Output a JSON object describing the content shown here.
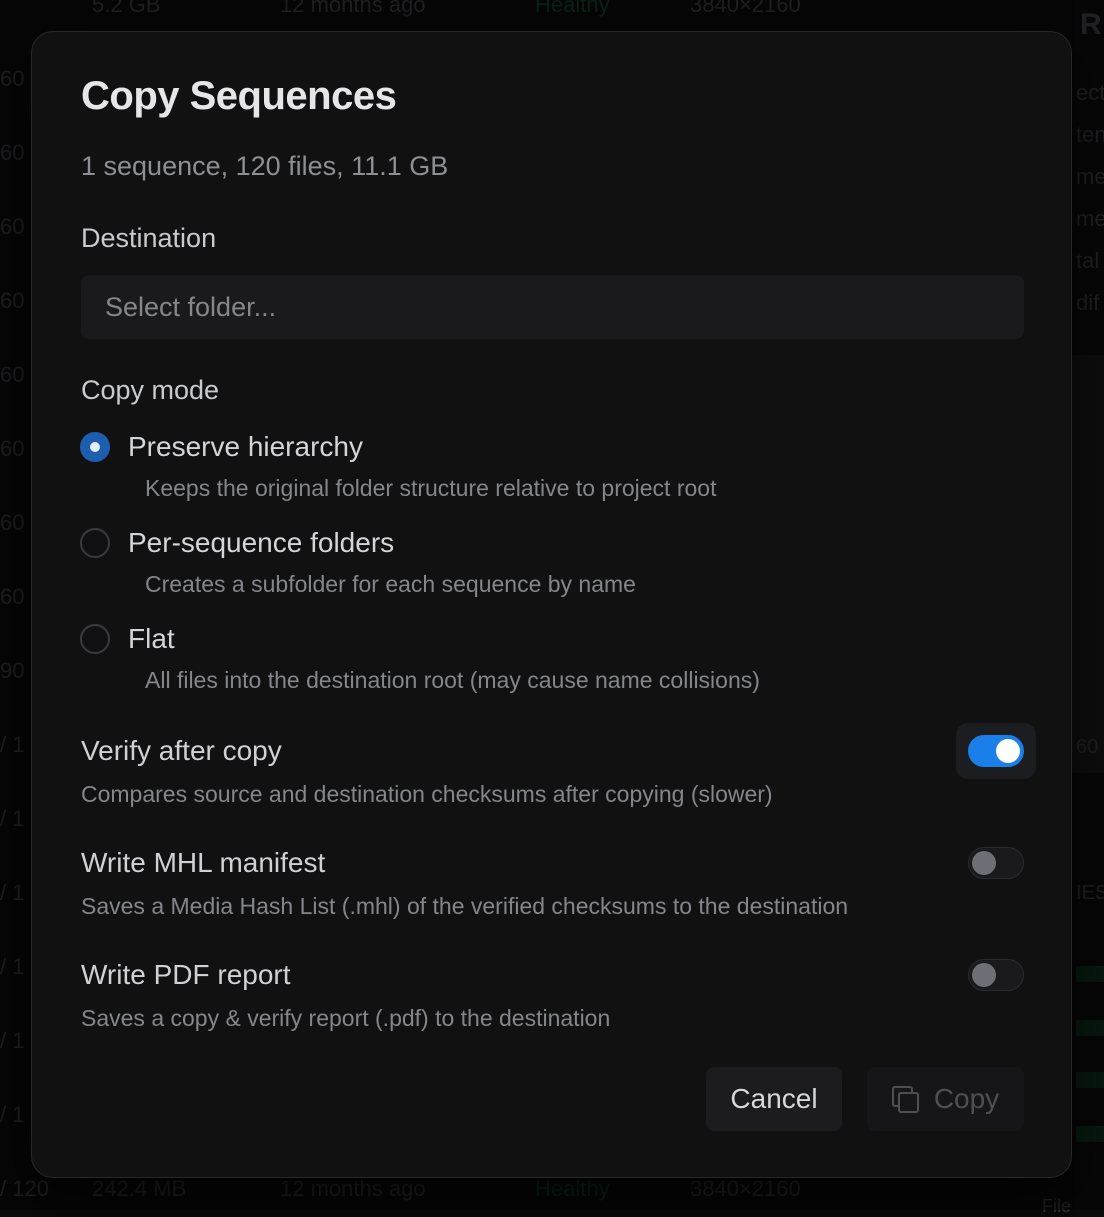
{
  "background": {
    "top_row": {
      "size": "5.2 GB",
      "modified": "12 months ago",
      "status": "Healthy",
      "resolution": "3840×2160"
    },
    "row_numbers": [
      "60",
      "60",
      "60",
      "60",
      "60",
      "60",
      "60",
      "60",
      "90",
      "/ 1",
      "/ 1",
      "/ 1",
      "/ 1",
      "/ 1",
      "/ 1"
    ],
    "bottom_row": {
      "frames": "/ 120",
      "size": "242.4 MB",
      "modified": "12 months ago",
      "status": "Healthy",
      "resolution": "3840×2160"
    },
    "right_panel": {
      "title": "R",
      "labels": [
        "ect",
        "ten",
        "me",
        "me",
        "tal",
        "dif"
      ],
      "badge": "60",
      "section": "IES",
      "footer": "File"
    }
  },
  "dialog": {
    "title": "Copy Sequences",
    "summary": "1 sequence, 120 files, 11.1 GB",
    "destination": {
      "label": "Destination",
      "placeholder": "Select folder...",
      "value": ""
    },
    "copy_mode": {
      "label": "Copy mode",
      "selected": "preserve",
      "options": [
        {
          "id": "preserve",
          "label": "Preserve hierarchy",
          "description": "Keeps the original folder structure relative to project root"
        },
        {
          "id": "per-sequence",
          "label": "Per-sequence folders",
          "description": "Creates a subfolder for each sequence by name"
        },
        {
          "id": "flat",
          "label": "Flat",
          "description": "All files into the destination root (may cause name collisions)"
        }
      ]
    },
    "options": [
      {
        "title": "Verify after copy",
        "description": "Compares source and destination checksums after copying (slower)",
        "enabled": true
      },
      {
        "title": "Write MHL manifest",
        "description": "Saves a Media Hash List (.mhl) of the verified checksums to the destination",
        "enabled": false
      },
      {
        "title": "Write PDF report",
        "description": "Saves a copy & verify report (.pdf) to the destination",
        "enabled": false
      }
    ],
    "buttons": {
      "cancel": "Cancel",
      "copy": "Copy"
    }
  },
  "colors": {
    "accent": "#1a7fe8",
    "dialog_bg": "#111112",
    "page_bg": "#0b0b0c"
  }
}
